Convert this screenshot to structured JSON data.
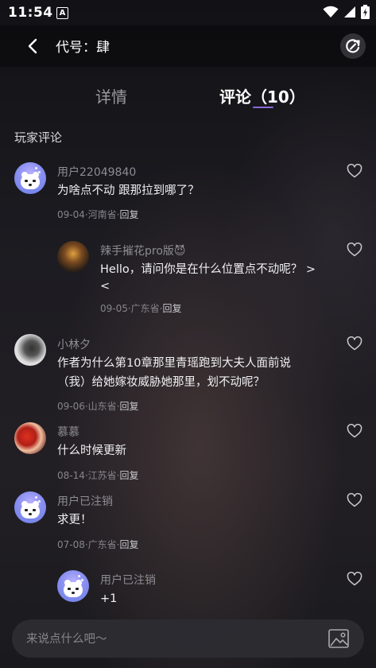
{
  "status_bar": {
    "time": "11:54",
    "notification_icon": "A"
  },
  "header": {
    "title": "代号：肆"
  },
  "tabs": [
    {
      "label": "详情"
    },
    {
      "label": "评论（10）"
    }
  ],
  "section_title": "玩家评论",
  "comments": [
    {
      "username": "用户22049840",
      "content_lines": [
        "为啥点不动 跟那拉到哪了？"
      ],
      "meta": "09-04·河南省·",
      "reply_label": "回复"
    },
    {
      "username": "辣手摧花pro版😈",
      "content_lines": [
        "Hello，请问你是在什么位置点不动呢？ >",
        "<"
      ],
      "meta": "09-05·广东省·",
      "reply_label": "回复"
    },
    {
      "username": "小林夕",
      "content_lines": [
        "作者为什么第10章那里青瑶跑到大夫人面前说",
        "（我）给她嫁妆威胁她那里，划不动呢？"
      ],
      "meta": "09-06·山东省·",
      "reply_label": "回复"
    },
    {
      "username": "慕慕",
      "content_lines": [
        "什么时候更新"
      ],
      "meta": "08-14·江苏省·",
      "reply_label": "回复"
    },
    {
      "username": "用户已注销",
      "content_lines": [
        "求更！"
      ],
      "meta": "07-08·广东省·",
      "reply_label": "回复"
    },
    {
      "username": "用户已注销",
      "content_lines": [
        "+1"
      ],
      "meta": "",
      "reply_label": ""
    }
  ],
  "input": {
    "placeholder": "来说点什么吧～"
  },
  "colors": {
    "accent": "#8b6ad8",
    "background": "#1b1a1f",
    "avatar_bear": "#8a8ff0"
  }
}
